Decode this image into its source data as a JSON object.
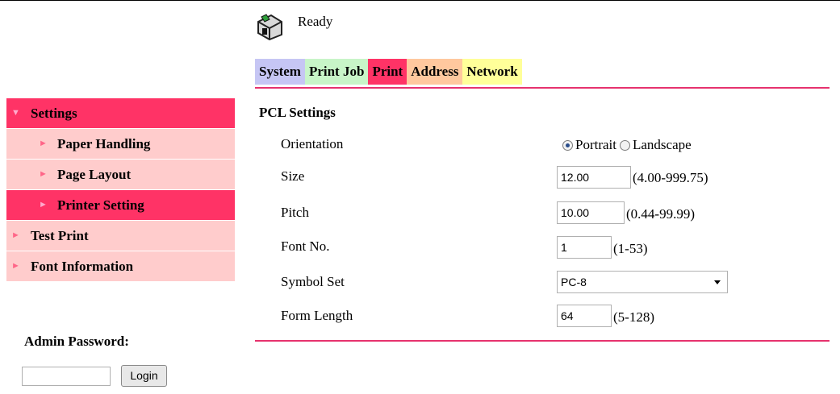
{
  "header": {
    "status_text": "Ready",
    "status_icon": "printer-icon"
  },
  "tabs": [
    {
      "label": "System"
    },
    {
      "label": "Print Job"
    },
    {
      "label": "Print"
    },
    {
      "label": "Address"
    },
    {
      "label": "Network"
    }
  ],
  "sidebar": {
    "items": [
      {
        "label": "Settings",
        "arrow": "▼"
      },
      {
        "label": "Paper Handling",
        "arrow": "►"
      },
      {
        "label": "Page Layout",
        "arrow": "►"
      },
      {
        "label": "Printer Setting",
        "arrow": "►"
      },
      {
        "label": "Test Print",
        "arrow": "►"
      },
      {
        "label": "Font Information",
        "arrow": "►"
      }
    ],
    "admin_label": "Admin Password:",
    "login_label": "Login"
  },
  "content": {
    "title": "PCL Settings",
    "orientation": {
      "label": "Orientation",
      "options": [
        "Portrait",
        "Landscape"
      ],
      "selected": "Portrait"
    },
    "size": {
      "label": "Size",
      "value": "12.00",
      "range": "(4.00-999.75)"
    },
    "pitch": {
      "label": "Pitch",
      "value": "10.00",
      "range": "(0.44-99.99)"
    },
    "font_no": {
      "label": "Font No.",
      "value": "1",
      "range": "(1-53)"
    },
    "symbol_set": {
      "label": "Symbol Set",
      "value": "PC-8"
    },
    "form_length": {
      "label": "Form Length",
      "value": "64",
      "range": "(5-128)"
    }
  },
  "colors": {
    "accent": "#ff3366",
    "rule": "#e6326e",
    "nav_bg": "#ffcccc"
  }
}
